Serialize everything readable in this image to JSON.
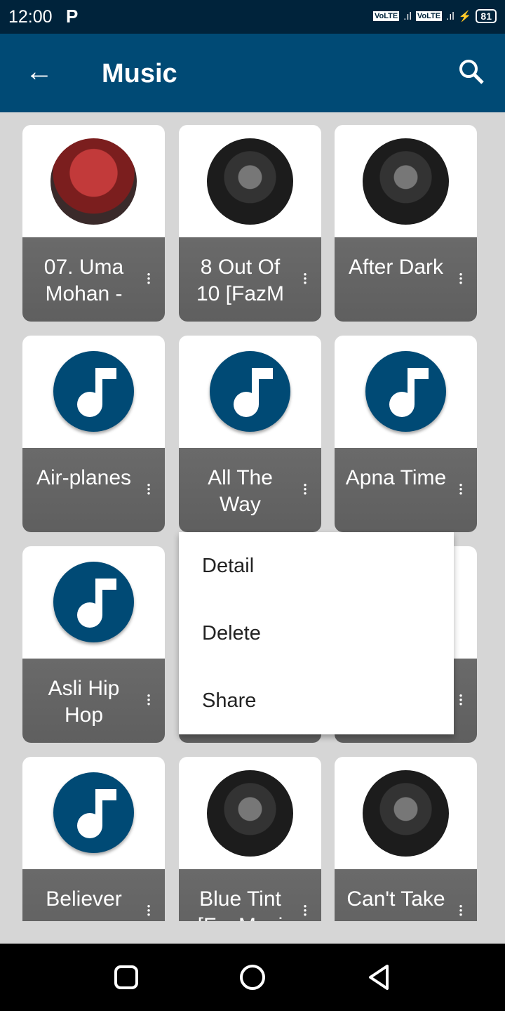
{
  "status_bar": {
    "time": "12:00",
    "notification_icon": "P",
    "volte1": "VoLTE",
    "volte2": "VoLTE",
    "battery": "81"
  },
  "app_bar": {
    "title": "Music",
    "back_icon": "arrow-left-icon",
    "search_icon": "search-icon"
  },
  "songs": [
    {
      "title": "07. Uma Mohan -",
      "art": "shakti"
    },
    {
      "title": "8 Out Of 10 [FazM",
      "art": "drake"
    },
    {
      "title": "After Dark",
      "art": "drake"
    },
    {
      "title": "Air-planes",
      "art": "note"
    },
    {
      "title": "All The Way",
      "art": "note"
    },
    {
      "title": "Apna Time",
      "art": "note"
    },
    {
      "title": "Asli Hip Hop",
      "art": "note"
    },
    {
      "title": "",
      "art": "note"
    },
    {
      "title": "",
      "art": "note"
    },
    {
      "title": "Believer",
      "art": "note"
    },
    {
      "title": "Blue Tint [FazMusi",
      "art": "drake"
    },
    {
      "title": "Can't Take",
      "art": "drake"
    }
  ],
  "context_menu": {
    "items": [
      "Detail",
      "Delete",
      "Share"
    ]
  },
  "colors": {
    "primary": "#004a75",
    "status_bar": "#00233b",
    "label_bg": "#646464"
  }
}
